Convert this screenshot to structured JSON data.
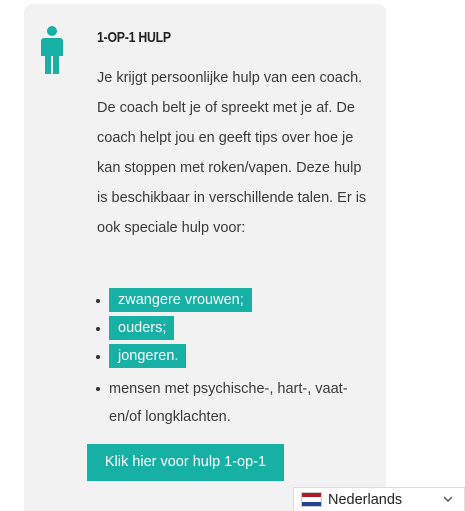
{
  "card": {
    "title": "1-OP-1 HULP",
    "description": "Je krijgt persoonlijke hulp van een coach. De coach belt je of spreekt met je af. De coach helpt jou en geeft tips over hoe je kan stoppen met roken/vapen. Deze hulp is beschikbaar in verschillende talen. Er is ook speciale hulp voor:",
    "list": [
      {
        "label": "zwangere vrouwen;"
      },
      {
        "label": "ouders;"
      },
      {
        "label": "jongeren."
      },
      {
        "label": "mensen met psychische-, hart-, vaat- en/of longklachten."
      }
    ],
    "cta_label": "Klik hier voor hulp 1-op-1"
  },
  "language": {
    "selected": "Nederlands",
    "flag_colors": [
      "#ae1c28",
      "#ffffff",
      "#21468b"
    ]
  },
  "colors": {
    "accent": "#17b0a4",
    "card_bg": "#f2f2f2"
  },
  "icons": {
    "person": "person-icon",
    "chevron": "chevron-down-icon",
    "flag": "netherlands-flag-icon"
  }
}
